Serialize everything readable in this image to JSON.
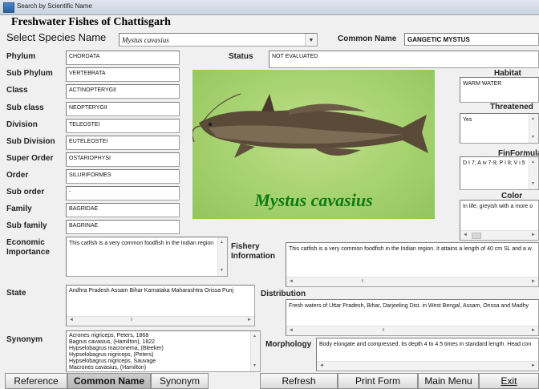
{
  "window": {
    "title": "Search by Scientific Name"
  },
  "header": {
    "title": "Freshwater Fishes of Chattisgarh",
    "select_label": "Select Species Name",
    "species_value": "Mystus cavasius",
    "common_name_label": "Common Name",
    "common_name_value": "GANGETIC MYSTUS"
  },
  "taxonomy": [
    {
      "label": "Phylum",
      "value": "CHORDATA"
    },
    {
      "label": "Sub Phylum",
      "value": "VERTEBRATA"
    },
    {
      "label": "Class",
      "value": "ACTINOPTERYGII"
    },
    {
      "label": "Sub class",
      "value": "NEOPTERYGII"
    },
    {
      "label": "Division",
      "value": "TELEOSTEI"
    },
    {
      "label": "Sub Division",
      "value": "EUTELEOSTEI"
    },
    {
      "label": "Super Order",
      "value": "OSTARIOPHYSI"
    },
    {
      "label": "Order",
      "value": "SILURIFORMES"
    },
    {
      "label": "Sub order",
      "value": "-"
    },
    {
      "label": "Family",
      "value": "BAGRIDAE"
    },
    {
      "label": "Sub family",
      "value": "BAGRINAE"
    }
  ],
  "status": {
    "label": "Status",
    "value": "NOT EVALUATED"
  },
  "image": {
    "caption": "Mystus cavasius"
  },
  "side": {
    "habitat_label": "Habitat",
    "habitat_value": "WARM WATER",
    "threatened_label": "Threatened",
    "threatened_value": "Yes",
    "finformula_label": "FinFormula",
    "finformula_value": "D I 7; A iv 7-9; P I 8; V i 5",
    "color_label": "Color",
    "color_value": "In life, greyish with a more o"
  },
  "economic": {
    "label_line1": "Economic",
    "label_line2": "Importance",
    "value": "This catfish is a very common foodfish in the Indian region"
  },
  "fishery": {
    "label_line1": "Fishery",
    "label_line2": "Information",
    "value": "This catfish is a very common foodfish in the Indian region. It attains a length of 40 cm SL and a w"
  },
  "state": {
    "label": "State",
    "value": "Andhra Pradesh  Assam  Bihar  Karnataka  Maharashtra  Orissa  Punj"
  },
  "distribution": {
    "label": "Distribution",
    "value": "Fresh waters of Uttar Pradesh, Bihar, Darjeeling Dist. in West Bengal, Assam,  Orissa and Madhy"
  },
  "synonym": {
    "label": "Synonym",
    "lines": [
      "Acrones nigriceps, Peters, 1868",
      "Bagrus cavasius, (Hamilton), 1822",
      "Hypselobagrus macronema, (Bleeker)",
      "Hypselobagrus nigriceps, (Peters)",
      "Hypselobagrus nigriceps, Sauvage",
      "Macrones cavasius, (Hamilton)"
    ]
  },
  "morphology": {
    "label": "Morphology",
    "value": "Body elongate and compressed, its depth 4 to 4.5 times in standard length. Head con"
  },
  "buttons": {
    "reference": "Reference",
    "common_name": "Common Name",
    "synonym": "Synonym",
    "refresh": "Refresh",
    "print_form": "Print Form",
    "main_menu": "Main Menu",
    "exit": "Exit"
  },
  "scroll": {
    "down_arrow": "▼",
    "up_arrow": "▲",
    "left_arrow": "◄",
    "right_arrow": "►",
    "grip": "III"
  },
  "icons": [
    "window-icon",
    "dropdown-arrow-icon",
    "fish-photo"
  ]
}
